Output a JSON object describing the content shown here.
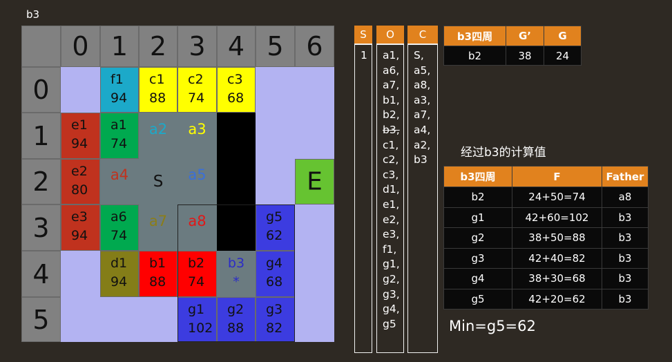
{
  "title": "b3",
  "grid": {
    "col_headers": [
      "0",
      "1",
      "2",
      "3",
      "4",
      "5",
      "6"
    ],
    "row_headers": [
      "0",
      "1",
      "2",
      "3",
      "4",
      "5"
    ],
    "cells": [
      {
        "r": 0,
        "c": 0,
        "type": "empty"
      },
      {
        "r": 0,
        "c": 1,
        "type": "label",
        "name": "f1",
        "value": "94",
        "bg": "#1ca9c9",
        "fg": "#111111"
      },
      {
        "r": 0,
        "c": 2,
        "type": "label",
        "name": "c1",
        "value": "88",
        "bg": "#ffff00",
        "fg": "#111111"
      },
      {
        "r": 0,
        "c": 3,
        "type": "label",
        "name": "c2",
        "value": "74",
        "bg": "#ffff00",
        "fg": "#111111"
      },
      {
        "r": 0,
        "c": 4,
        "type": "label",
        "name": "c3",
        "value": "68",
        "bg": "#ffff00",
        "fg": "#111111"
      },
      {
        "r": 0,
        "c": 5,
        "type": "empty"
      },
      {
        "r": 0,
        "c": 6,
        "type": "empty"
      },
      {
        "r": 1,
        "c": 0,
        "type": "label",
        "name": "e1",
        "value": "94",
        "bg": "#c0321e",
        "fg": "#111111"
      },
      {
        "r": 1,
        "c": 1,
        "type": "label",
        "name": "a1",
        "value": "74",
        "bg": "#00a94f",
        "fg": "#111111"
      },
      {
        "r": 1,
        "c": 2,
        "type": "center",
        "name": "a2",
        "bg": "#6b7b80",
        "fg": "#1ca9c9"
      },
      {
        "r": 1,
        "c": 3,
        "type": "center",
        "name": "a3",
        "bg": "#6b7b80",
        "fg": "#ffff00"
      },
      {
        "r": 1,
        "c": 4,
        "type": "wall"
      },
      {
        "r": 1,
        "c": 5,
        "type": "empty"
      },
      {
        "r": 1,
        "c": 6,
        "type": "empty"
      },
      {
        "r": 2,
        "c": 0,
        "type": "label",
        "name": "e2",
        "value": "80",
        "bg": "#c0321e",
        "fg": "#111111"
      },
      {
        "r": 2,
        "c": 1,
        "type": "center",
        "name": "a4",
        "bg": "#6b7b80",
        "fg": "#c0321e"
      },
      {
        "r": 2,
        "c": 2,
        "type": "center",
        "name": "S",
        "bg": "#6b7b80",
        "fg": "#111111"
      },
      {
        "r": 2,
        "c": 3,
        "type": "center",
        "name": "a5",
        "bg": "#6b7b80",
        "fg": "#3a6fd8"
      },
      {
        "r": 2,
        "c": 4,
        "type": "wall"
      },
      {
        "r": 2,
        "c": 5,
        "type": "empty"
      },
      {
        "r": 2,
        "c": 6,
        "type": "big",
        "name": "E",
        "bg": "#66c331",
        "fg": "#111111"
      },
      {
        "r": 3,
        "c": 0,
        "type": "label",
        "name": "e3",
        "value": "94",
        "bg": "#c0321e",
        "fg": "#111111"
      },
      {
        "r": 3,
        "c": 1,
        "type": "label",
        "name": "a6",
        "value": "74",
        "bg": "#00a94f",
        "fg": "#111111"
      },
      {
        "r": 3,
        "c": 2,
        "type": "center",
        "name": "a7",
        "bg": "#6b7b80",
        "fg": "#8b7d18"
      },
      {
        "r": 3,
        "c": 3,
        "type": "center",
        "name": "a8",
        "bg": "#6b7b80",
        "fg": "#e01818"
      },
      {
        "r": 3,
        "c": 4,
        "type": "wall"
      },
      {
        "r": 3,
        "c": 5,
        "type": "label",
        "name": "g5",
        "value": "62",
        "bg": "#3c3ce0",
        "fg": "#111111"
      },
      {
        "r": 3,
        "c": 6,
        "type": "empty"
      },
      {
        "r": 4,
        "c": 0,
        "type": "empty"
      },
      {
        "r": 4,
        "c": 1,
        "type": "label",
        "name": "d1",
        "value": "94",
        "bg": "#847d18",
        "fg": "#111111"
      },
      {
        "r": 4,
        "c": 2,
        "type": "label",
        "name": "b1",
        "value": "88",
        "bg": "#ff0000",
        "fg": "#111111"
      },
      {
        "r": 4,
        "c": 3,
        "type": "label",
        "name": "b2",
        "value": "74",
        "bg": "#ff0000",
        "fg": "#111111"
      },
      {
        "r": 4,
        "c": 4,
        "type": "star",
        "name": "b3",
        "value": "*",
        "bg": "#6b7b80",
        "fg": "#2b2bc8"
      },
      {
        "r": 4,
        "c": 5,
        "type": "label",
        "name": "g4",
        "value": "68",
        "bg": "#3c3ce0",
        "fg": "#111111"
      },
      {
        "r": 4,
        "c": 6,
        "type": "empty"
      },
      {
        "r": 5,
        "c": 0,
        "type": "empty"
      },
      {
        "r": 5,
        "c": 1,
        "type": "empty"
      },
      {
        "r": 5,
        "c": 2,
        "type": "empty"
      },
      {
        "r": 5,
        "c": 3,
        "type": "label",
        "name": "g1",
        "value": "102",
        "bg": "#3c3ce0",
        "fg": "#111111"
      },
      {
        "r": 5,
        "c": 4,
        "type": "label",
        "name": "g2",
        "value": "88",
        "bg": "#3c3ce0",
        "fg": "#111111"
      },
      {
        "r": 5,
        "c": 5,
        "type": "label",
        "name": "g3",
        "value": "82",
        "bg": "#3c3ce0",
        "fg": "#111111"
      },
      {
        "r": 5,
        "c": 6,
        "type": "empty"
      }
    ]
  },
  "lists": {
    "s": {
      "header": "S",
      "items": [
        "1"
      ]
    },
    "o": {
      "header": "O",
      "items": [
        "a1,",
        "a6,",
        "a7,",
        "b1,",
        "b2,",
        "b3,",
        "c1,",
        "c2,",
        "c3,",
        "d1,",
        "e1,",
        "e2,",
        "e3,",
        "f1,",
        "g1,",
        "g2,",
        "g3,",
        "g4,",
        "g5"
      ],
      "struck": [
        "b3,"
      ]
    },
    "c": {
      "header": "C",
      "items": [
        "S,",
        "a5,",
        "a8,",
        "a3,",
        "a7,",
        "a4,",
        "a2,",
        "b3"
      ]
    }
  },
  "top_table": {
    "headers": [
      "b3四周",
      "G’",
      "G"
    ],
    "rows": [
      [
        "b2",
        "38",
        "24"
      ]
    ]
  },
  "note": "经过b3的计算值",
  "calc_table": {
    "headers": [
      "b3四周",
      "F",
      "Father"
    ],
    "rows": [
      [
        "b2",
        "24+50=74",
        "a8"
      ],
      [
        "g1",
        "42+60=102",
        "b3"
      ],
      [
        "g2",
        "38+50=88",
        "b3"
      ],
      [
        "g3",
        "42+40=82",
        "b3"
      ],
      [
        "g4",
        "38+30=68",
        "b3"
      ],
      [
        "g5",
        "42+20=62",
        "b3"
      ]
    ]
  },
  "result": "Min=g5=62",
  "colors": {
    "background": "#2e2923",
    "header_gray": "#818181",
    "empty_cell": "#b3b3f2",
    "wall": "#000000",
    "orange_header": "#e1821e"
  }
}
